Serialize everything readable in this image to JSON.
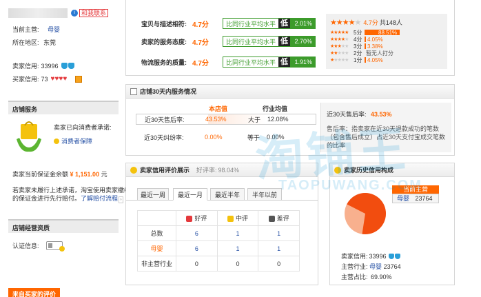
{
  "seller": {
    "contact_badge": "和我联系",
    "manager_label": "当前主营:",
    "manager_value": "母婴",
    "region_label": "所在地区:",
    "region_value": "东莞",
    "seller_credit_label": "卖家信用:",
    "seller_credit_value": "33996",
    "buyer_credit_label": "买家信用:",
    "buyer_credit_value": "73"
  },
  "shop_service": {
    "title": "店铺服务",
    "promise_label": "卖家已向消费者承诺:",
    "guarantee_link": "消费者保障",
    "deposit_label": "卖家当前保证金余额",
    "deposit_value": "¥ 1,151.00",
    "deposit_unit": "元",
    "note": "若卖家未履行上述承诺，淘宝使用卖家缴纳的保证金进行先行赔付。",
    "note_link": "了解赔付流程"
  },
  "shop_qualification": {
    "title": "店铺经营资质",
    "cert_label": "认证信息:"
  },
  "buyer_reviews_tab": "来自买家的评价",
  "dsr": {
    "rows": [
      {
        "label": "宝贝与描述相符:",
        "score": "4.7分",
        "compare": "比同行业平均水平",
        "level": "低",
        "pct": "2.01%",
        "fill": 0.45
      },
      {
        "label": "卖家的服务态度:",
        "score": "4.7分",
        "compare": "比同行业平均水平",
        "level": "低",
        "pct": "2.70%",
        "fill": 0.6
      },
      {
        "label": "物流服务的质量:",
        "score": "4.7分",
        "compare": "比同行业平均水平",
        "level": "低",
        "pct": "1.91%",
        "fill": 0.42
      }
    ],
    "summary_score": "4.7分",
    "summary_count": "共148人",
    "dist": [
      {
        "label": "5分",
        "pct": "88.51%",
        "fill": 0.8851
      },
      {
        "label": "4分",
        "pct": "4.05%",
        "fill": 0.0405
      },
      {
        "label": "3分",
        "pct": "3.38%",
        "fill": 0.0338
      },
      {
        "label": "2分",
        "pct": "暂无人打分",
        "fill": 0
      },
      {
        "label": "1分",
        "pct": "4.05%",
        "fill": 0.0405
      }
    ]
  },
  "service30": {
    "title": "店铺30天内服务情况",
    "col_store": "本店值",
    "col_industry": "行业均值",
    "rows": [
      {
        "label": "近30天售后率:",
        "store": "43.53%",
        "compare": "大于",
        "industry": "12.08%"
      },
      {
        "label": "近30天纠纷率:",
        "store": "0.00%",
        "compare": "等于",
        "industry": "0.00%"
      }
    ],
    "side_label": "近30天售后率:",
    "side_value": "43.53%",
    "side_note": "售后率：指卖家在近30天退款成功的笔数（包含售后成立）占近30天支付宝成交笔数的比率"
  },
  "credit_panel": {
    "title": "卖家信用评价展示",
    "rate_label": "好评率:",
    "rate_value": "98.04%",
    "tabs": [
      "最近一周",
      "最近一月",
      "最近半年",
      "半年以前"
    ],
    "headers": [
      "好评",
      "中评",
      "差评"
    ],
    "rows": [
      {
        "label": "总数",
        "values": [
          "6",
          "1",
          "1"
        ]
      },
      {
        "label": "母婴",
        "values": [
          "6",
          "1",
          "1"
        ]
      },
      {
        "label": "非主营行业",
        "values": [
          "0",
          "0",
          "0"
        ]
      }
    ]
  },
  "history": {
    "title": "卖家历史信用构成",
    "tooltip_title": "当前主营",
    "tooltip_cat": "母婴",
    "tooltip_value": "23764",
    "seller_credit_label": "卖家信用:",
    "seller_credit_value": "33996",
    "main_credit_label": "主营行业:",
    "main_credit_cat": "母婴",
    "main_credit_value": "23764",
    "share_label": "主营占比:",
    "share_value": "69.90%",
    "share_fraction": 0.699
  },
  "watermark": {
    "main": "淘铺王",
    "sub": "TAOPUWANG.COM"
  },
  "colors": {
    "accent": "#f60",
    "green": "#3c9b2b",
    "link": "#2953a6",
    "red": "#e4393c"
  }
}
